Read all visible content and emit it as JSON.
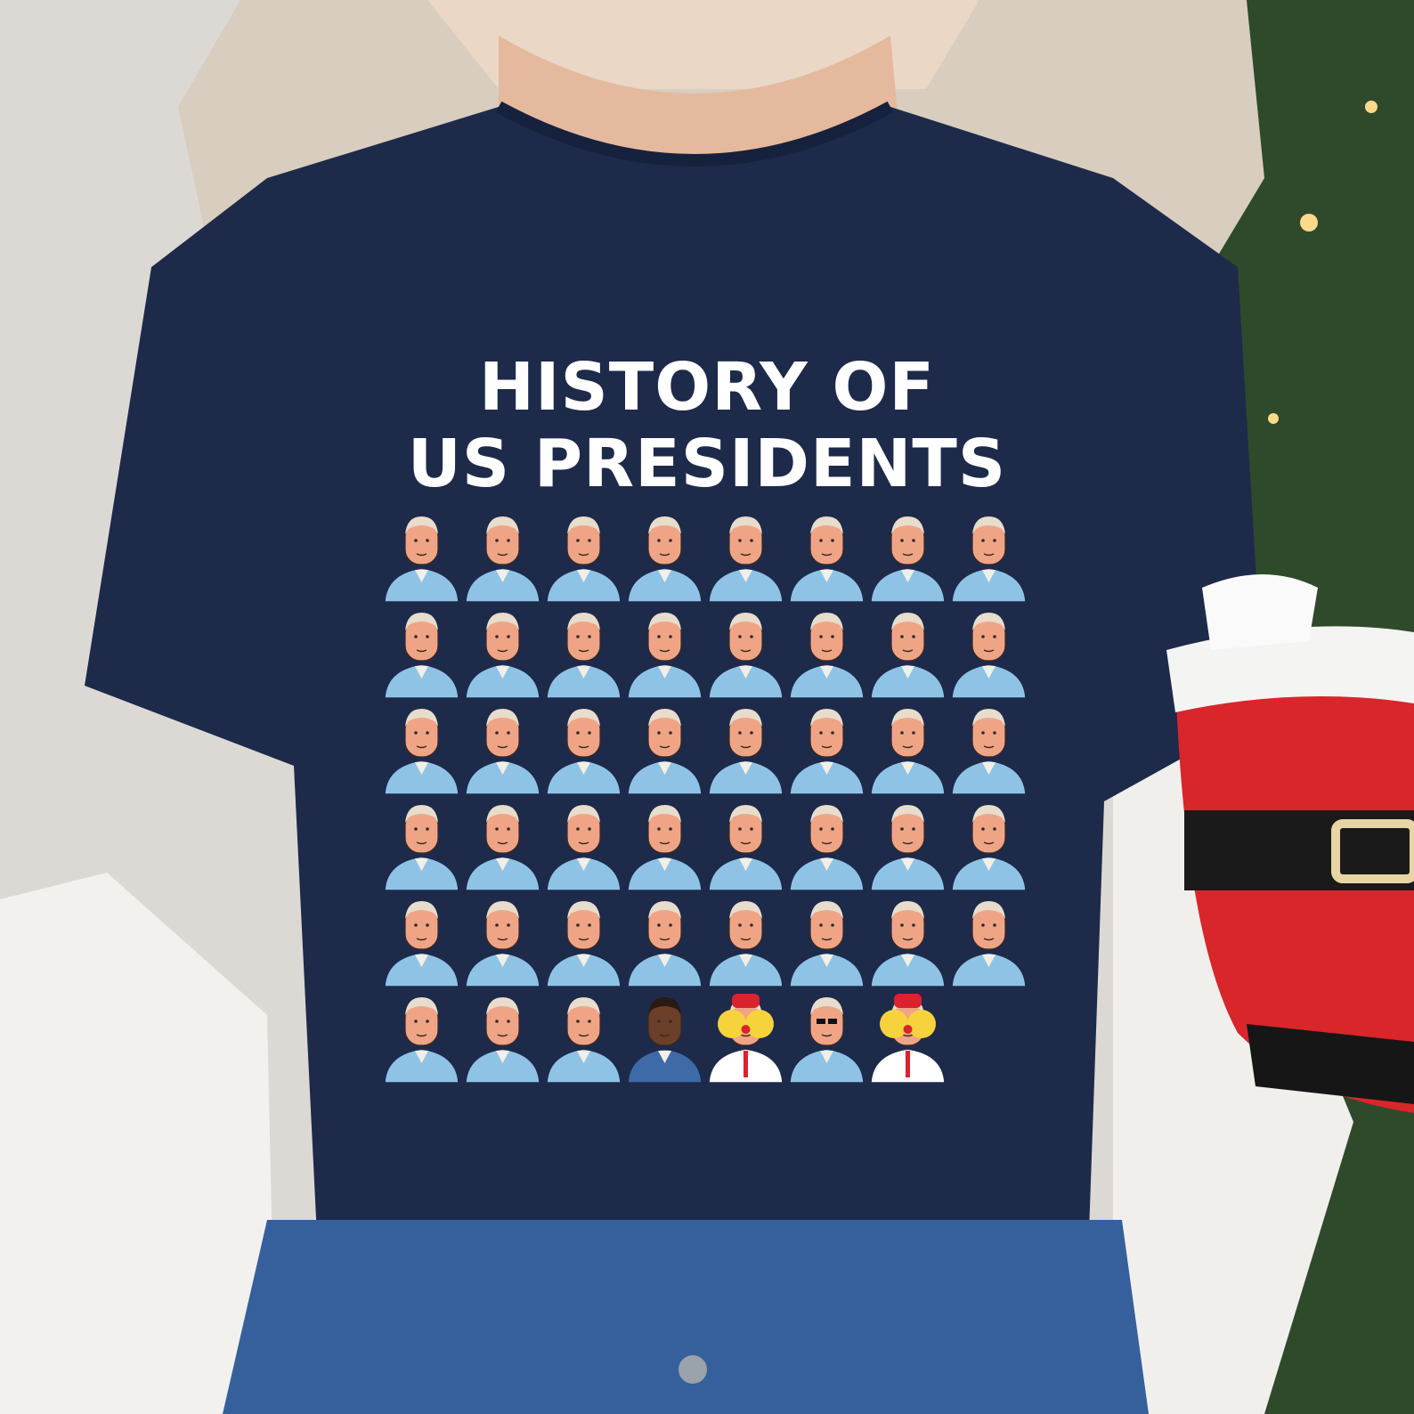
{
  "shirt": {
    "title_line_1": "HISTORY OF",
    "title_line_2": "US PRESIDENTS",
    "color": "#1e2a4a"
  },
  "portraits": {
    "rows": [
      [
        "standard",
        "standard",
        "standard",
        "standard",
        "standard",
        "standard",
        "standard",
        "standard"
      ],
      [
        "standard",
        "standard",
        "standard",
        "standard",
        "standard",
        "standard",
        "standard",
        "standard"
      ],
      [
        "standard",
        "standard",
        "standard",
        "standard",
        "standard",
        "standard",
        "standard",
        "standard"
      ],
      [
        "standard",
        "standard",
        "standard",
        "standard",
        "standard",
        "standard",
        "standard",
        "standard"
      ],
      [
        "standard",
        "standard",
        "standard",
        "standard",
        "standard",
        "standard",
        "standard",
        "standard"
      ],
      [
        "standard",
        "standard",
        "standard",
        "dark",
        "clown",
        "sunglasses",
        "clown"
      ]
    ],
    "colors": {
      "suit": "#8fc3e6",
      "suit_dark": "#3e6aa8",
      "skin": "#f0a486",
      "skin_dark": "#6b3f2a",
      "hair": "#e8dccb",
      "clown_wig": "#f6d33c",
      "clown_hat": "#d9232e",
      "clown_suit": "#ffffff"
    }
  }
}
